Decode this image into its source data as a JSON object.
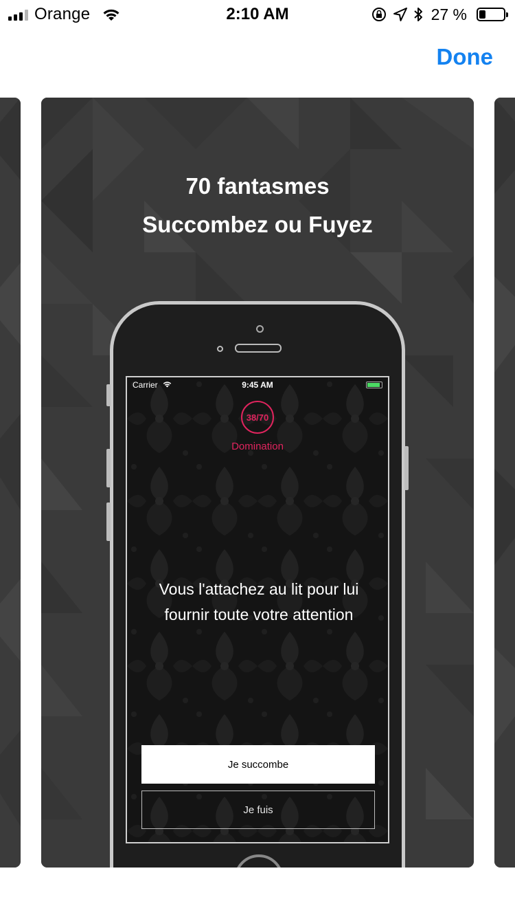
{
  "status_bar": {
    "carrier": "Orange",
    "time": "2:10 AM",
    "battery_percent": "27 %",
    "battery_level": 0.27
  },
  "nav": {
    "done_label": "Done"
  },
  "card": {
    "line1": "70 fantasmes",
    "line2": "Succombez ou Fuyez"
  },
  "device": {
    "status": {
      "carrier": "Carrier",
      "time": "9:45 AM"
    },
    "counter": "38/70",
    "category": "Domination",
    "prompt": "Vous l'attachez au lit pour lui fournir toute votre attention",
    "primary_button": "Je succombe",
    "secondary_button": "Je fuis"
  },
  "colors": {
    "accent_blue": "#1482f0",
    "accent_pink": "#e0245e",
    "card_bg": "#3a3a3a"
  }
}
